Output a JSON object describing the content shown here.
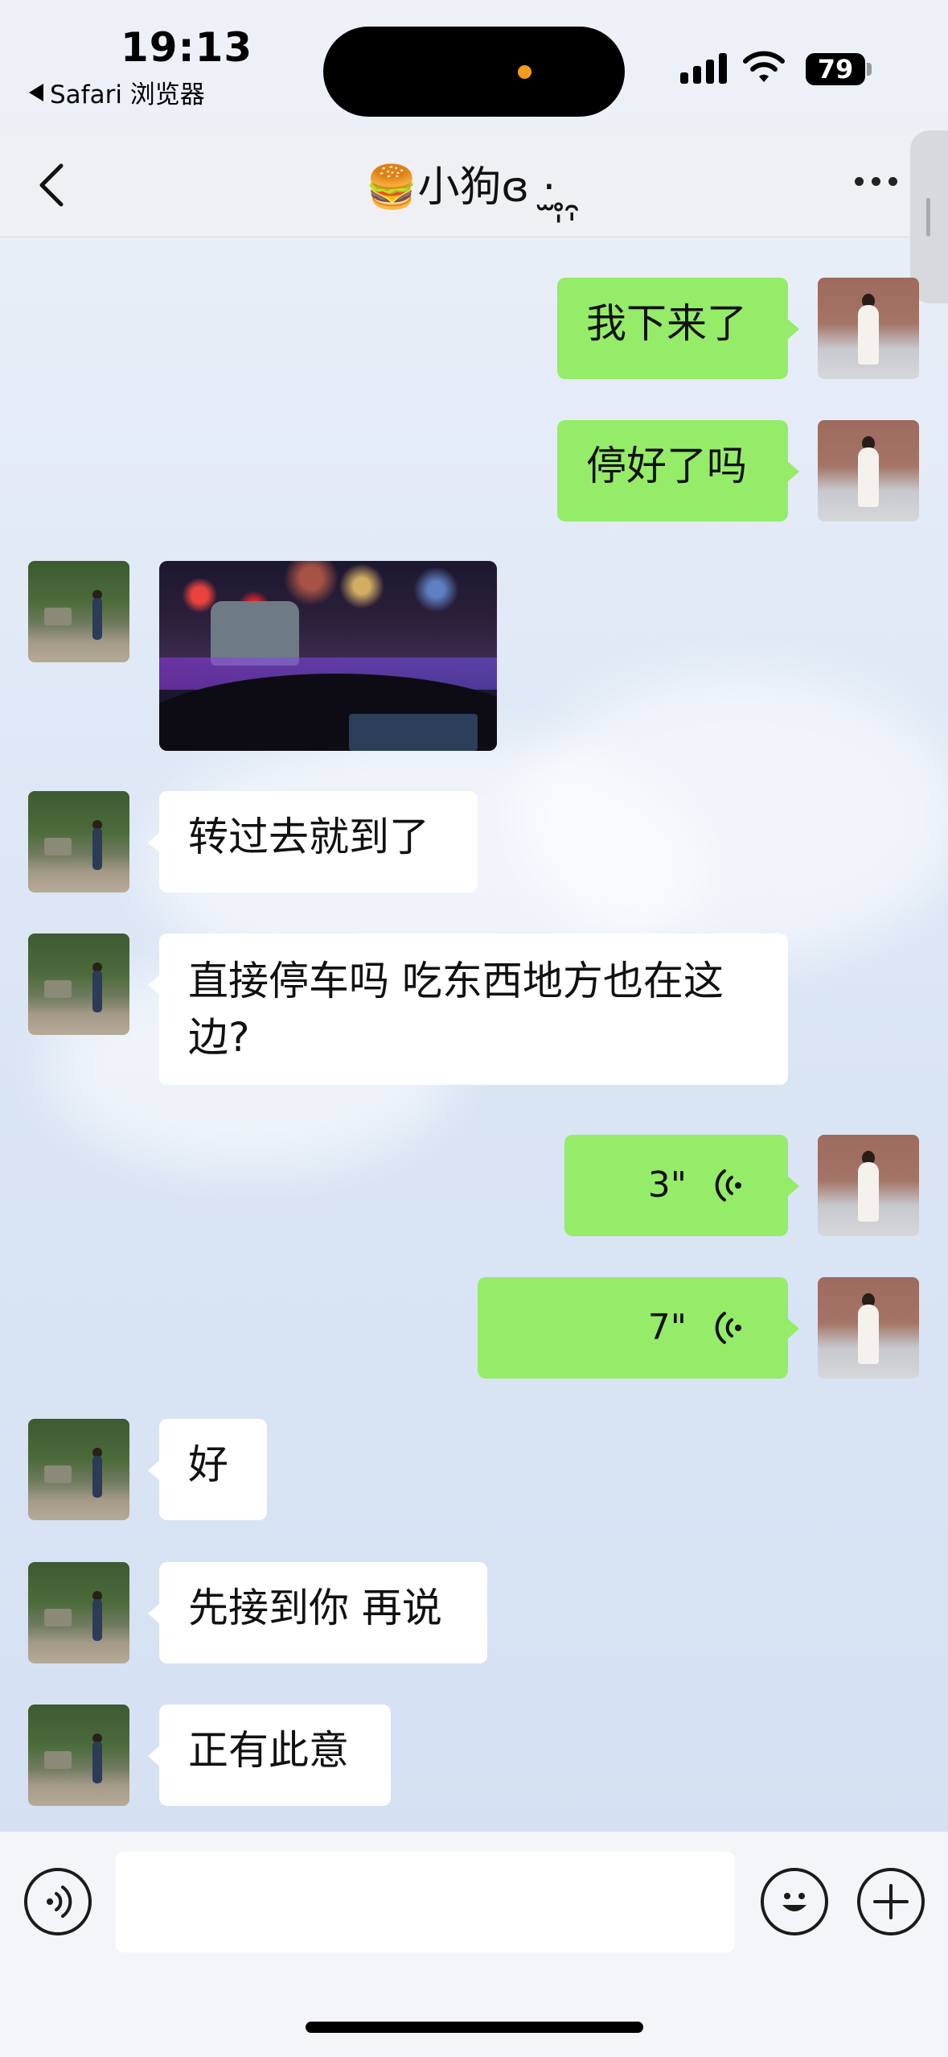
{
  "status_bar": {
    "time": "19:13",
    "back_app": "Safari 浏览器",
    "battery": "79"
  },
  "nav": {
    "title": "🍔小狗ɞ ·̫ ̥̩ ̯̩",
    "back_icon": "chevron-left-icon",
    "more_icon": "ellipsis-icon"
  },
  "messages": [
    {
      "from": "me",
      "type": "text",
      "text": "我下来了"
    },
    {
      "from": "me",
      "type": "text",
      "text": "停好了吗"
    },
    {
      "from": "friend",
      "type": "image",
      "description": "photo"
    },
    {
      "from": "friend",
      "type": "text",
      "text": "转过去就到了"
    },
    {
      "from": "friend",
      "type": "text",
      "text": "直接停车吗 吃东西地方也在这边?"
    },
    {
      "from": "me",
      "type": "voice",
      "duration": "3\""
    },
    {
      "from": "me",
      "type": "voice",
      "duration": "7\""
    },
    {
      "from": "friend",
      "type": "text",
      "text": "好"
    },
    {
      "from": "friend",
      "type": "text",
      "text": "先接到你 再说"
    },
    {
      "from": "friend",
      "type": "text",
      "text": "正有此意"
    }
  ],
  "input_bar": {
    "voice_icon": "voice-input-icon",
    "emoji_icon": "emoji-icon",
    "plus_icon": "plus-icon",
    "placeholder": ""
  },
  "colors": {
    "my_bubble": "#95ec69",
    "friend_bubble": "#ffffff",
    "nav_bg": "#eff0f4"
  }
}
